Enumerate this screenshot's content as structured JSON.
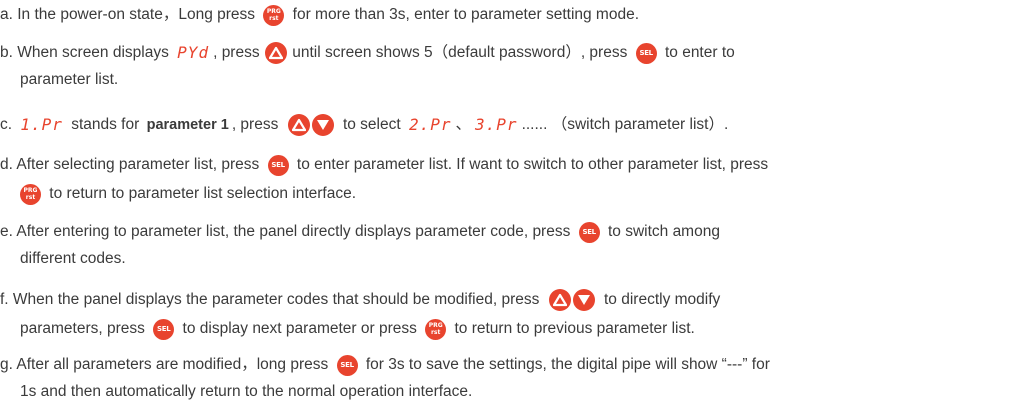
{
  "steps": {
    "a": {
      "t1": "a. In the power-on state，Long press ",
      "t2": " for more than 3s, enter to parameter setting mode."
    },
    "b": {
      "t1": "b. When screen displays ",
      "seg": "PYd",
      "t2": ", press ",
      "t3": " until screen shows 5（default password）, press ",
      "t4": " to enter to",
      "t5": "parameter list."
    },
    "c": {
      "t1": "c. ",
      "seg1": "1.Pr",
      "t2": " stands for ",
      "bold": "parameter 1",
      "t3": ", press ",
      "t4": " to select ",
      "seg2": "2.Pr",
      "t5": "、",
      "seg3": "3.Pr",
      "t6": "...... （switch parameter list）."
    },
    "d": {
      "t1": "d. After selecting parameter list, press ",
      "t2": " to enter parameter list. If want to switch to other parameter list, press",
      "t3": " to return to parameter list selection interface."
    },
    "e": {
      "t1": "e. After entering to parameter list, the panel directly displays parameter code, press ",
      "t2": " to switch among",
      "t3": "different codes."
    },
    "f": {
      "t1": "f. When the panel displays the parameter codes that should be modified, press ",
      "t2": " to directly modify",
      "t3": "parameters, press ",
      "t4": " to display next parameter or press ",
      "t5": " to return to previous parameter list."
    },
    "g": {
      "t1": "g. After all parameters are modified，long press ",
      "t2": " for 3s to save the settings, the digital pipe will show “---” for",
      "t3": "1s and then automatically return to the normal operation interface."
    }
  },
  "buttons": {
    "sel": "SEL",
    "prg_top": "PRG",
    "prg_bottom": "rst"
  },
  "colors": {
    "accent": "#e8442e",
    "text": "#3b3b3b"
  }
}
